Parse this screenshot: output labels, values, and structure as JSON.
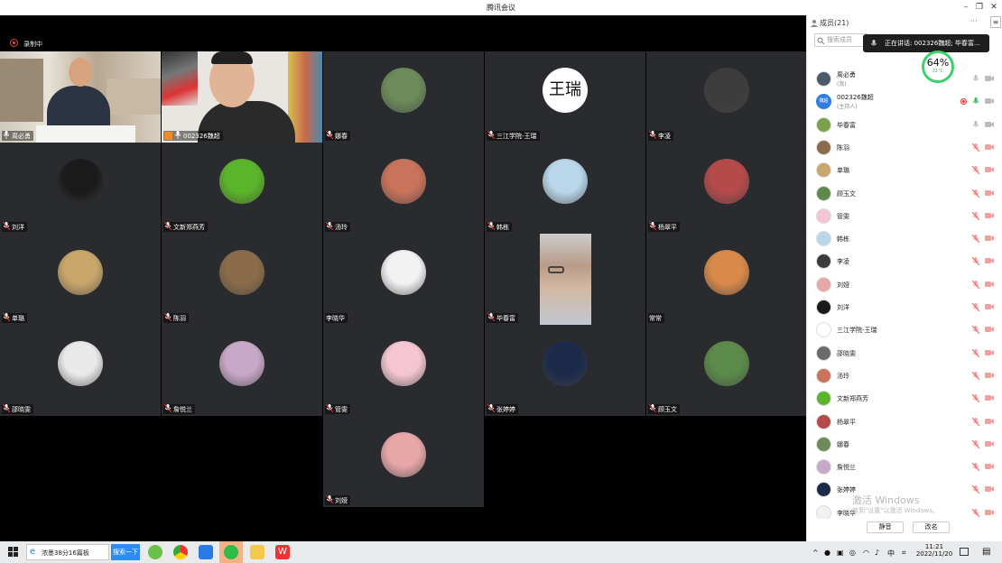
{
  "window": {
    "title": "腾讯会议"
  },
  "recording": {
    "label": "录制中"
  },
  "tiles": [
    {
      "name": "周必勇",
      "mic": "on",
      "kind": "video1",
      "col": 0,
      "row": 0
    },
    {
      "name": "002326魏超",
      "mic": "on",
      "kind": "video2",
      "col": 1,
      "row": 0,
      "active": true,
      "host": true
    },
    {
      "name": "娜春",
      "mic": "off",
      "kind": "avatar",
      "color": "#6c8a5a",
      "col": 2,
      "row": 0
    },
    {
      "name": "三江学院-王瑞",
      "mic": "off",
      "kind": "calli",
      "col": 3,
      "row": 0
    },
    {
      "name": "李凌",
      "mic": "off",
      "kind": "avatar",
      "color": "#3c3c3c",
      "col": 4,
      "row": 0
    },
    {
      "name": "刘洋",
      "mic": "off",
      "kind": "avatar",
      "color": "#1a1a1a",
      "col": 0,
      "row": 1
    },
    {
      "name": "文新郑燕芳",
      "mic": "off",
      "kind": "avatar",
      "color": "#5bb52a",
      "col": 1,
      "row": 1
    },
    {
      "name": "汤玲",
      "mic": "off",
      "kind": "avatar",
      "color": "#c8735a",
      "col": 2,
      "row": 1
    },
    {
      "name": "韩栋",
      "mic": "off",
      "kind": "avatar",
      "color": "#b9d6ea",
      "col": 3,
      "row": 1
    },
    {
      "name": "杨翠平",
      "mic": "off",
      "kind": "avatar",
      "color": "#b44a4a",
      "col": 4,
      "row": 1
    },
    {
      "name": "单璐",
      "mic": "off",
      "kind": "avatar",
      "color": "#c9a66b",
      "col": 0,
      "row": 2
    },
    {
      "name": "陈羽",
      "mic": "off",
      "kind": "avatar",
      "color": "#8a6c4a",
      "col": 1,
      "row": 2
    },
    {
      "name": "李晓华",
      "mic": "none",
      "kind": "avatar",
      "color": "#f2f2f2",
      "col": 2,
      "row": 2
    },
    {
      "name": "毕春富",
      "mic": "off",
      "kind": "video3",
      "col": 3,
      "row": 2
    },
    {
      "name": "常常",
      "mic": "none",
      "kind": "avatar",
      "color": "#d98a4a",
      "col": 4,
      "row": 2
    },
    {
      "name": "邵晓雯",
      "mic": "off",
      "kind": "avatar",
      "color": "#e9e9e9",
      "col": 0,
      "row": 3
    },
    {
      "name": "詹悦兰",
      "mic": "off",
      "kind": "avatar",
      "color": "#c8a8c8",
      "col": 1,
      "row": 3
    },
    {
      "name": "管雯",
      "mic": "off",
      "kind": "avatar",
      "color": "#f4c6d2",
      "col": 2,
      "row": 3
    },
    {
      "name": "张婷婷",
      "mic": "off",
      "kind": "avatar",
      "color": "#1c2a4a",
      "col": 3,
      "row": 3
    },
    {
      "name": "顾玉文",
      "mic": "off",
      "kind": "avatar",
      "color": "#5c8a4a",
      "col": 4,
      "row": 3
    },
    {
      "name": "刘娅",
      "mic": "off",
      "kind": "avatar",
      "color": "#e7a7a7",
      "col": 2,
      "row": 4
    }
  ],
  "panel": {
    "title": "成员(21)",
    "more": "···",
    "search_placeholder": "搜索成员",
    "speaking_tooltip": "正在讲话: 002326魏超; 毕春富...",
    "cpu_percent": "64%",
    "cpu_temp": "31°C",
    "members": [
      {
        "name": "周必勇",
        "sub": "(我)",
        "color": "#4a5a6a",
        "mic": "gray",
        "cam": "gray"
      },
      {
        "name": "002326魏超",
        "sub": "(主持人)",
        "color": "#2f7de1",
        "badge": "魏超",
        "mic": "green",
        "cam": "gray",
        "rec": true
      },
      {
        "name": "毕春富",
        "color": "#7aa04a",
        "mic": "gray",
        "cam": "gray"
      },
      {
        "name": "陈羽",
        "color": "#8a6c4a",
        "mic": "off",
        "cam": "off"
      },
      {
        "name": "单璐",
        "color": "#c9a66b",
        "mic": "off",
        "cam": "off"
      },
      {
        "name": "顾玉文",
        "color": "#5c8a4a",
        "mic": "off",
        "cam": "off"
      },
      {
        "name": "管雯",
        "color": "#f4c6d2",
        "mic": "off",
        "cam": "off"
      },
      {
        "name": "韩栋",
        "color": "#b9d6ea",
        "mic": "off",
        "cam": "off"
      },
      {
        "name": "李凌",
        "color": "#3c3c3c",
        "mic": "off",
        "cam": "off"
      },
      {
        "name": "刘娅",
        "color": "#e7a7a7",
        "mic": "off",
        "cam": "off"
      },
      {
        "name": "刘洋",
        "color": "#1a1a1a",
        "mic": "off",
        "cam": "off"
      },
      {
        "name": "三江学院-王瑞",
        "color": "#ffffff",
        "mic": "off",
        "cam": "off"
      },
      {
        "name": "邵晓雯",
        "color": "#6a6a6a",
        "mic": "off",
        "cam": "off"
      },
      {
        "name": "汤玲",
        "color": "#c8735a",
        "mic": "off",
        "cam": "off"
      },
      {
        "name": "文新郑燕芳",
        "color": "#5bb52a",
        "mic": "off",
        "cam": "off"
      },
      {
        "name": "杨翠平",
        "color": "#b44a4a",
        "mic": "off",
        "cam": "off"
      },
      {
        "name": "娜春",
        "color": "#6c8a5a",
        "mic": "off",
        "cam": "off"
      },
      {
        "name": "詹悦兰",
        "color": "#c8a8c8",
        "mic": "off",
        "cam": "off"
      },
      {
        "name": "张婷婷",
        "color": "#1c2a4a",
        "mic": "off",
        "cam": "off"
      },
      {
        "name": "李晓华",
        "color": "#f2f2f2",
        "mic": "off",
        "cam": "off"
      }
    ],
    "mute_all_label": "静音",
    "rename_label": "改名"
  },
  "watermark": {
    "line1": "激活 Windows",
    "line2": "转到\"设置\"以激活 Windows。"
  },
  "taskbar": {
    "ie_label": "浓墨38分16篇板",
    "search_button": "搜索一下",
    "ime": "中",
    "time": "11:21",
    "date": "2022/11/20"
  }
}
